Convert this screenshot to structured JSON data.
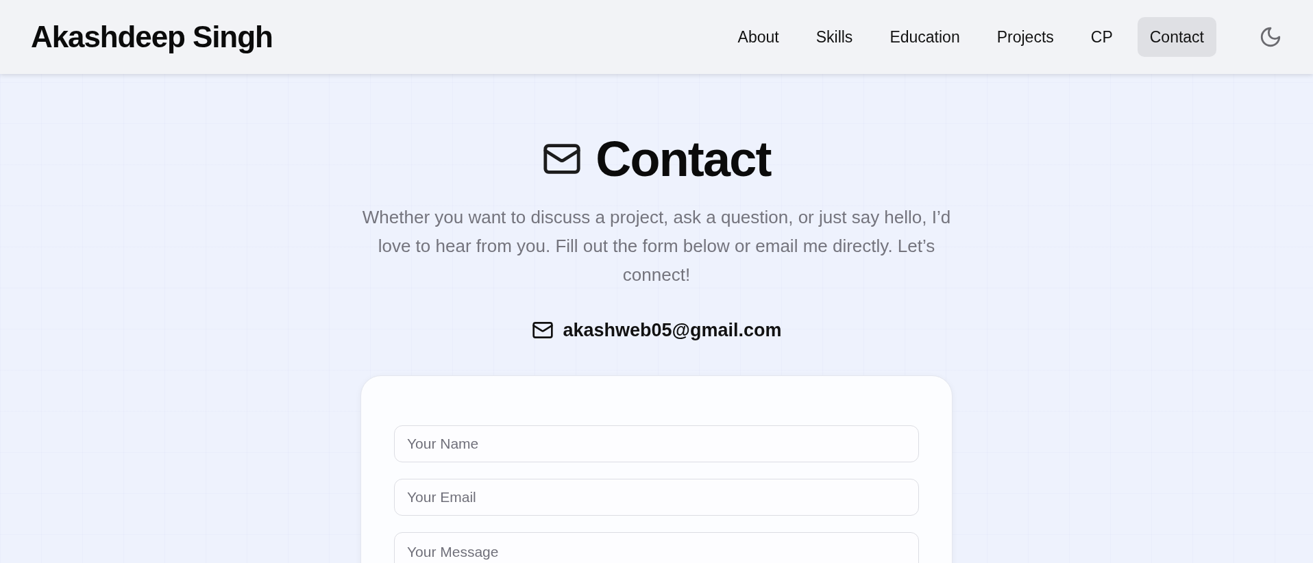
{
  "header": {
    "brand": "Akashdeep Singh",
    "nav": [
      {
        "label": "About",
        "selected": false
      },
      {
        "label": "Skills",
        "selected": false
      },
      {
        "label": "Education",
        "selected": false
      },
      {
        "label": "Projects",
        "selected": false
      },
      {
        "label": "CP",
        "selected": false
      },
      {
        "label": "Contact",
        "selected": true
      }
    ]
  },
  "contact": {
    "title": "Contact",
    "intro": "Whether you want to discuss a project, ask a question, or just say hello, I’d love to hear from you. Fill out the form below or email me directly. Let’s connect!",
    "email": "akashweb05@gmail.com",
    "form": {
      "fields": [
        {
          "kind": "input",
          "placeholder": "Your Name"
        },
        {
          "kind": "input",
          "placeholder": "Your Email"
        },
        {
          "kind": "textarea",
          "placeholder": "Your Message"
        }
      ]
    }
  }
}
